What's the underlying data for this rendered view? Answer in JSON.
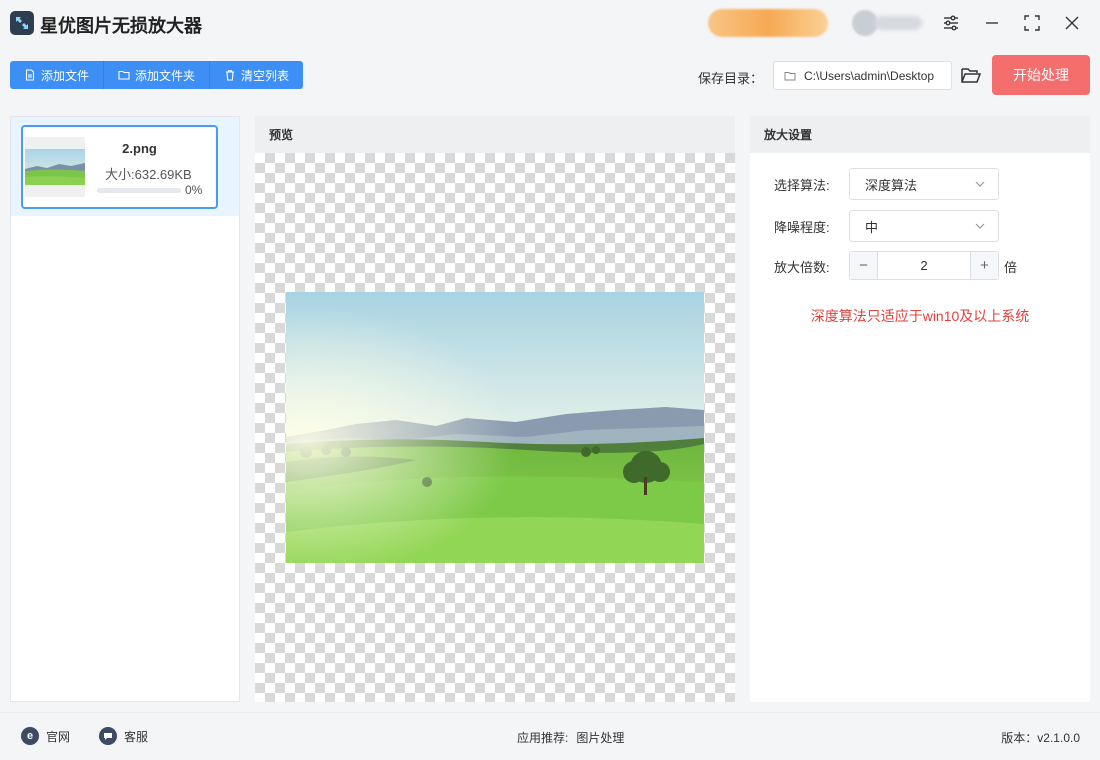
{
  "app": {
    "title": "星优图片无损放大器"
  },
  "toolbar": {
    "add_file": "添加文件",
    "add_folder": "添加文件夹",
    "clear_list": "清空列表",
    "save_dir_label": "保存目录：",
    "save_dir_path": "C:\\Users\\admin\\Desktop",
    "start": "开始处理"
  },
  "file_list": {
    "items": [
      {
        "name": "2.png",
        "size": "大小:632.69KB",
        "progress": 0,
        "progress_text": "0%"
      }
    ]
  },
  "preview": {
    "title": "预览"
  },
  "settings": {
    "title": "放大设置",
    "algorithm_label": "选择算法:",
    "algorithm_value": "深度算法",
    "noise_label": "降噪程度:",
    "noise_value": "中",
    "scale_label": "放大倍数:",
    "scale_value": "2",
    "scale_minus": "−",
    "scale_plus": "+",
    "scale_unit": "倍",
    "warning": "深度算法只适应于win10及以上系统"
  },
  "footer": {
    "website": "官网",
    "support": "客服",
    "recommend_label": "应用推荐:",
    "recommend_link": "图片处理",
    "version": "版本：v2.1.0.0"
  },
  "colors": {
    "primary": "#3d8ff5",
    "start_button": "#f46e6e",
    "warning": "#e0423c",
    "selected_border": "#4a9bf5"
  }
}
